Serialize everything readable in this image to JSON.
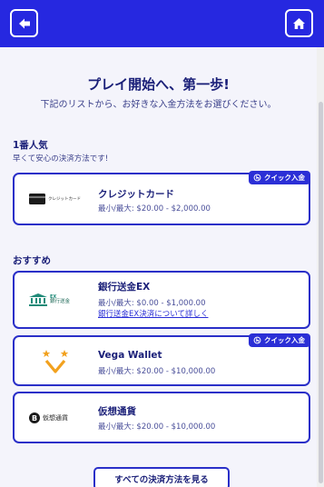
{
  "header": {
    "back_icon": "back-arrow-icon",
    "home_icon": "home-icon",
    "color": "#2628e0"
  },
  "intro": {
    "title": "プレイ開始へ、第一歩!",
    "subtitle": "下記のリストから、お好きな入金方法をお選びください。"
  },
  "sections": {
    "popular": {
      "title": "1番人気",
      "subtitle": "早くて安心の決済方法です!"
    },
    "recommended": {
      "title": "おすすめ"
    }
  },
  "methods": {
    "credit_card": {
      "logo_text": "クレジットカード",
      "name": "クレジットカード",
      "limits": "最小/最大: $20.00 - $2,000.00",
      "badge": "クイック入金"
    },
    "bank_ex": {
      "logo_top": "EX",
      "logo_text": "銀行送金",
      "name": "銀行送金EX",
      "limits": "最小/最大: $0.00 - $1,000.00",
      "link": "銀行送金EX決済について詳しく"
    },
    "vega": {
      "name": "Vega Wallet",
      "limits": "最小/最大: $20.00 - $10,000.00",
      "badge": "クイック入金"
    },
    "crypto": {
      "logo_text": "仮想通貨",
      "name": "仮想通貨",
      "limits": "最小/最大: $20.00 - $10,000.00"
    }
  },
  "footer": {
    "all_methods_label": "すべての決済方法を見る"
  }
}
